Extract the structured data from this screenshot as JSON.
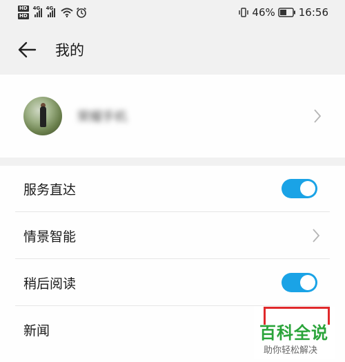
{
  "status_bar": {
    "hd_badges": [
      "HD",
      "HD"
    ],
    "signal_labels": [
      "4G",
      "4G"
    ],
    "battery": "46%",
    "time": "16:56"
  },
  "header": {
    "title": "我的",
    "back_icon": "back-arrow-icon"
  },
  "profile": {
    "name": "荣耀手机"
  },
  "settings": {
    "rows": [
      {
        "label": "服务直达",
        "control": "toggle",
        "state": true
      },
      {
        "label": "情景智能",
        "control": "chevron"
      },
      {
        "label": "稍后阅读",
        "control": "toggle",
        "state": true
      },
      {
        "label": "新闻",
        "control": "none"
      }
    ]
  },
  "watermark": {
    "main": "百科全说",
    "sub": "助你轻松解决"
  },
  "colors": {
    "accent": "#1aa3e6",
    "background": "#f1f1f1",
    "card": "#fefefe",
    "watermark_green": "#2aa43a",
    "watermark_red": "#e0292b"
  }
}
